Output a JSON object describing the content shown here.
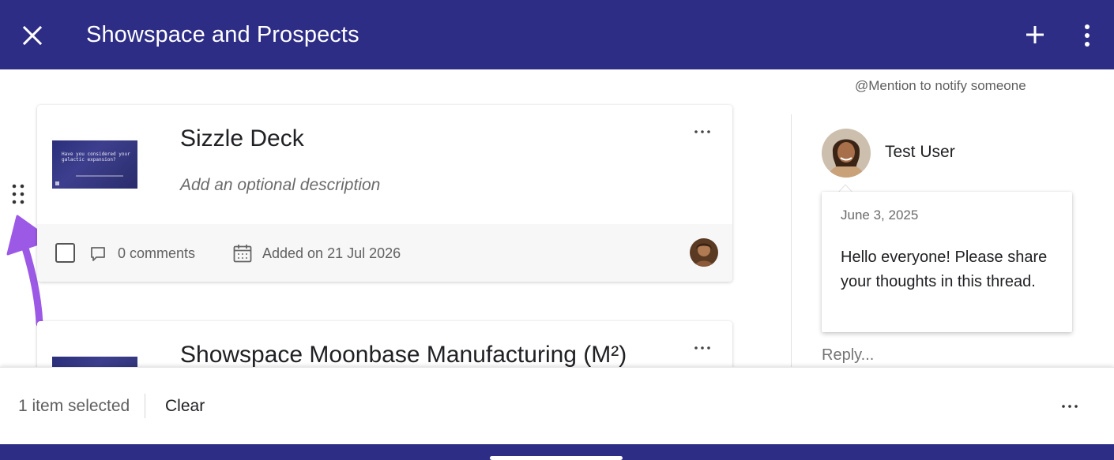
{
  "header": {
    "title": "Showspace and Prospects",
    "bg_color": "#2e2d86"
  },
  "cards": [
    {
      "title": "Sizzle Deck",
      "description_placeholder": "Add an optional description",
      "thumbnail_text": "Have you considered your galactic expansion?",
      "comments": "0 comments",
      "added": "Added on 21 Jul 2026",
      "selected": true
    },
    {
      "title": "Showspace Moonbase Manufacturing (M²)"
    }
  ],
  "comments_panel": {
    "mention_hint": "@Mention to notify someone",
    "user_name": "Test User",
    "date": "June 3, 2025",
    "message": "Hello everyone! Please share your thoughts in this thread.",
    "reply_placeholder": "Reply..."
  },
  "selection_bar": {
    "count_text": "1 item selected",
    "clear_label": "Clear"
  },
  "icons": {
    "close": "close-icon",
    "add": "plus-icon",
    "menu": "more-vertical-icon",
    "drag": "drag-handle-icon",
    "comment": "comment-icon",
    "calendar": "calendar-icon",
    "more": "more-horizontal-icon"
  },
  "colors": {
    "accent": "#2e2d86",
    "annotation_arrow": "#9b59e6"
  }
}
